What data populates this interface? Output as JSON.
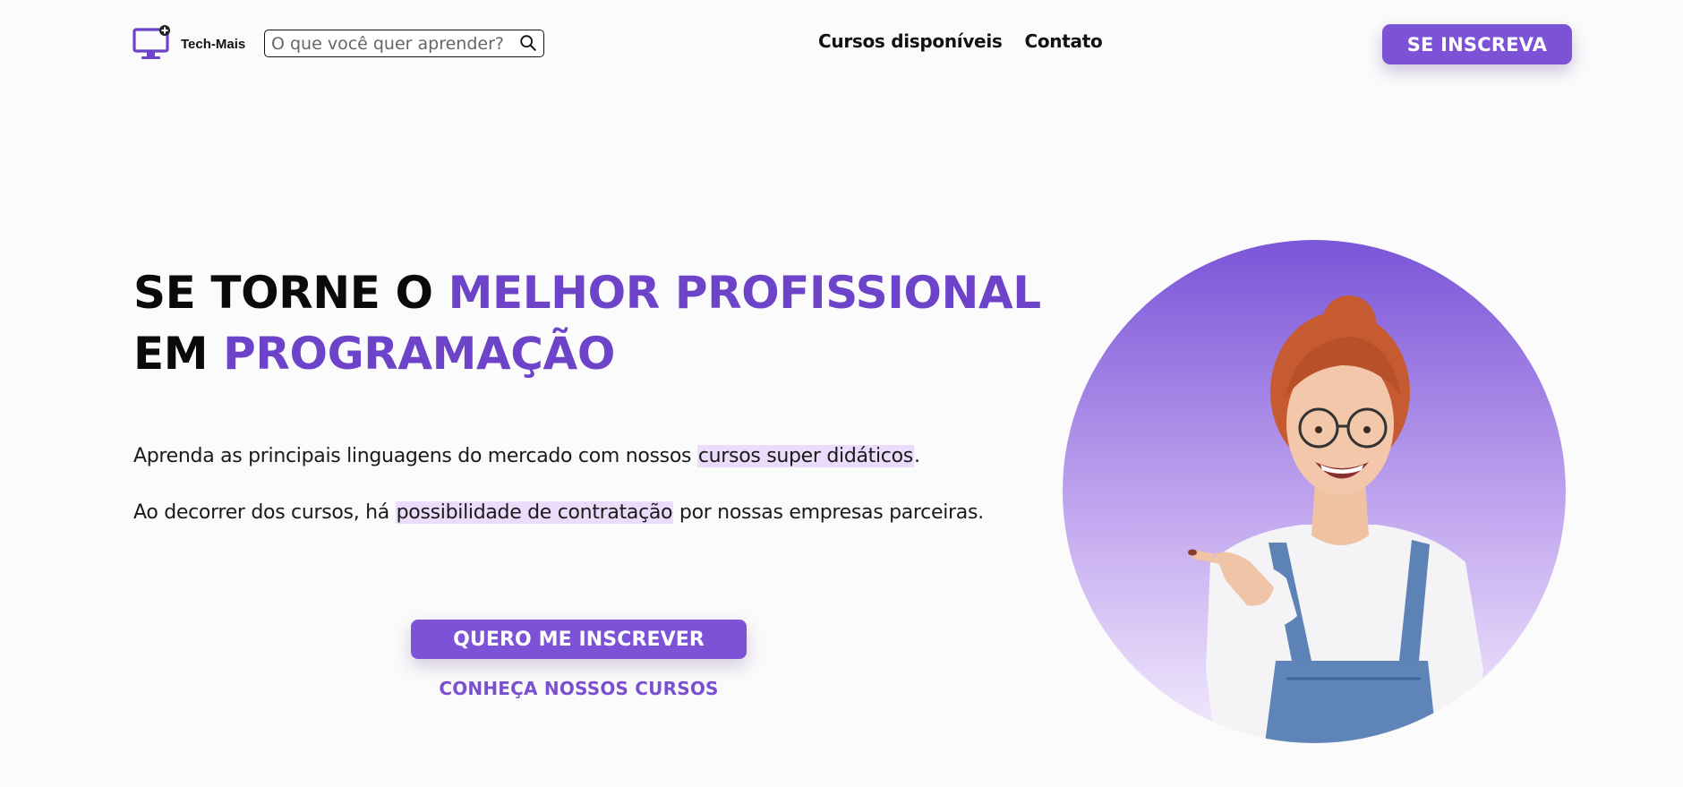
{
  "header": {
    "brand": "Tech-Mais",
    "search": {
      "placeholder": "O que você quer aprender?",
      "value": ""
    },
    "nav": [
      "Cursos disponíveis",
      "Contato"
    ],
    "cta_label": "SE INSCREVA"
  },
  "hero": {
    "title": {
      "line1_plain": "SE TORNE O ",
      "line1_accent": "MELHOR PROFISSIONAL",
      "line2_plain": "EM ",
      "line2_accent": "PROGRAMAÇÃO"
    },
    "paragraph1": {
      "before": "Aprenda as principais linguagens do mercado com nossos ",
      "highlight": "cursos super didáticos",
      "after": "."
    },
    "paragraph2": {
      "before": "Ao decorrer dos cursos, há ",
      "highlight": "possibilidade de contratação",
      "after": " por nossas empresas parceiras."
    },
    "primary_cta": "QUERO ME INSCREVER",
    "secondary_link": "CONHEÇA NOSSOS CURSOS",
    "image": "smiling-student-pointing-photo"
  },
  "colors": {
    "accent": "#7c52d6",
    "accent_text": "#6d43c9",
    "highlight": "#ecdcfb",
    "background": "#fbfbfb"
  },
  "icons": [
    "computer-plus-logo-icon",
    "search-icon"
  ]
}
